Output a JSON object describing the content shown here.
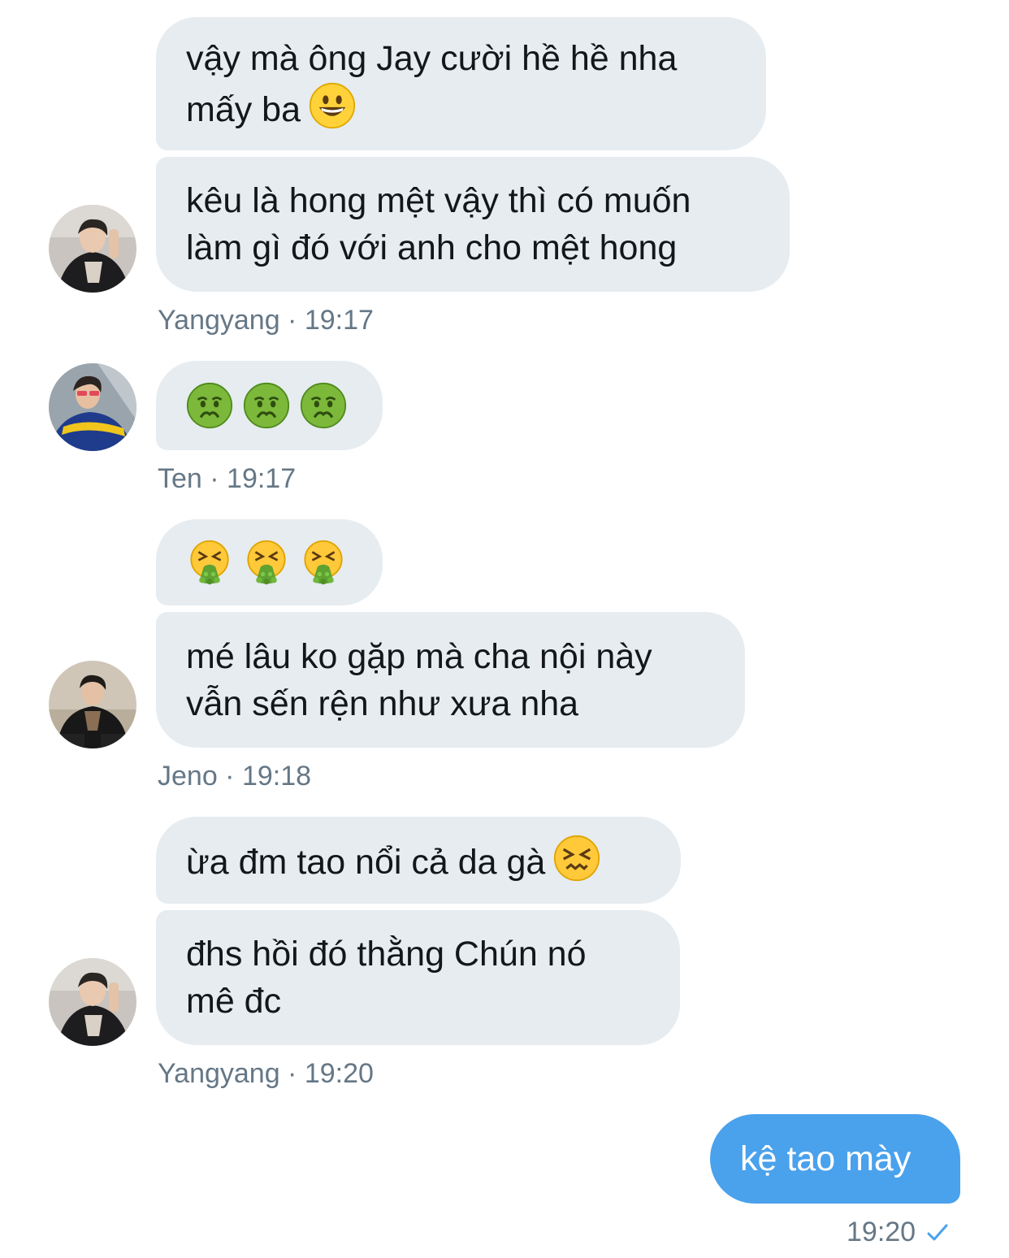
{
  "messages": {
    "m1": {
      "line1": "vậy mà ông Jay cười hề hề nha",
      "line2": "mấy ba",
      "emoji": "grinning-face-icon"
    },
    "m2": {
      "line1": "kêu là hong mệt vậy thì có muốn",
      "line2": "làm gì đó với anh cho mệt hong"
    },
    "group1_meta": "Yangyang · 19:17",
    "m3": {
      "emoji": "nauseated-face-icon",
      "count": 3
    },
    "group2_meta": "Ten · 19:17",
    "m4": {
      "emoji": "vomiting-face-icon",
      "count": 3
    },
    "m5": {
      "line1": "mé lâu ko gặp mà cha nội này",
      "line2": "vẫn sến rện như xưa nha"
    },
    "group3_meta": "Jeno · 19:18",
    "m6": {
      "line1": "ừa đm tao nổi cả da gà",
      "emoji": "confounded-face-icon"
    },
    "m7": {
      "line1": "đhs hồi đó thằng Chún nó",
      "line2": "mê đc"
    },
    "group4_meta": "Yangyang · 19:20",
    "out1": {
      "text": "kệ tao mày"
    },
    "out1_time": "19:20",
    "out1_status": "checkmark-icon"
  },
  "avatars": {
    "yangyang": "avatar-yangyang",
    "ten": "avatar-ten",
    "jeno": "avatar-jeno"
  },
  "colors": {
    "incoming_bubble": "#e6ecf0",
    "outgoing_bubble": "#4aa1ec",
    "meta_text": "#657786",
    "message_text": "#14171a"
  }
}
